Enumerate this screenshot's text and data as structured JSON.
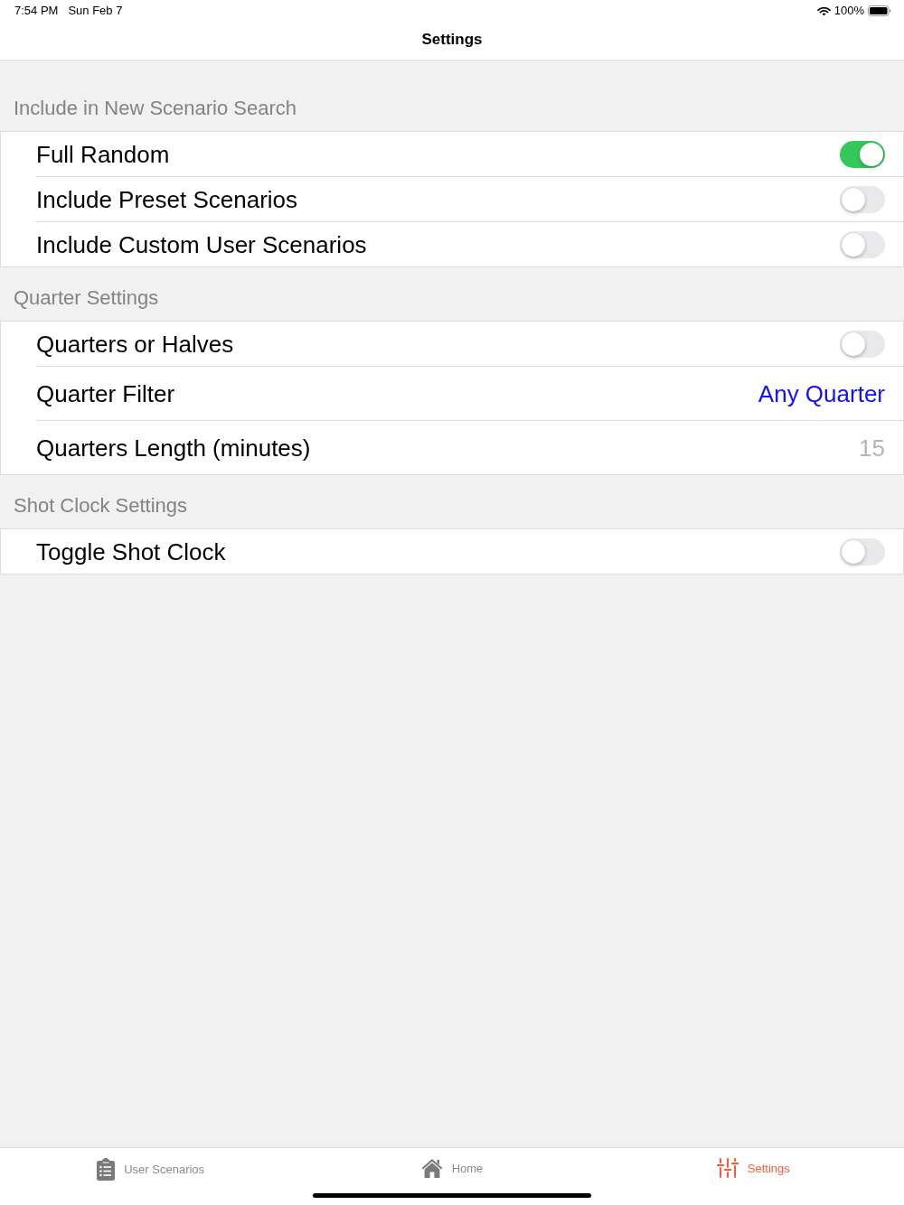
{
  "status_bar": {
    "time": "7:54 PM",
    "date": "Sun Feb 7",
    "battery": "100%"
  },
  "nav": {
    "title": "Settings"
  },
  "sections": [
    {
      "header": "Include in New Scenario Search",
      "rows": [
        {
          "kind": "toggle",
          "label": "Full Random",
          "on": true
        },
        {
          "kind": "toggle",
          "label": "Include Preset Scenarios",
          "on": false
        },
        {
          "kind": "toggle",
          "label": "Include Custom User Scenarios",
          "on": false
        }
      ]
    },
    {
      "header": "Quarter Settings",
      "rows": [
        {
          "kind": "toggle",
          "label": "Quarters or Halves",
          "on": false
        },
        {
          "kind": "link",
          "label": "Quarter Filter",
          "value": "Any Quarter"
        },
        {
          "kind": "value",
          "label": "Quarters Length (minutes)",
          "value": "15"
        }
      ]
    },
    {
      "header": "Shot Clock Settings",
      "rows": [
        {
          "kind": "toggle",
          "label": "Toggle Shot Clock",
          "on": false
        }
      ]
    }
  ],
  "tab_bar": {
    "items": [
      {
        "label": "User Scenarios",
        "selected": false
      },
      {
        "label": "Home",
        "selected": false
      },
      {
        "label": "Settings",
        "selected": true
      }
    ]
  }
}
